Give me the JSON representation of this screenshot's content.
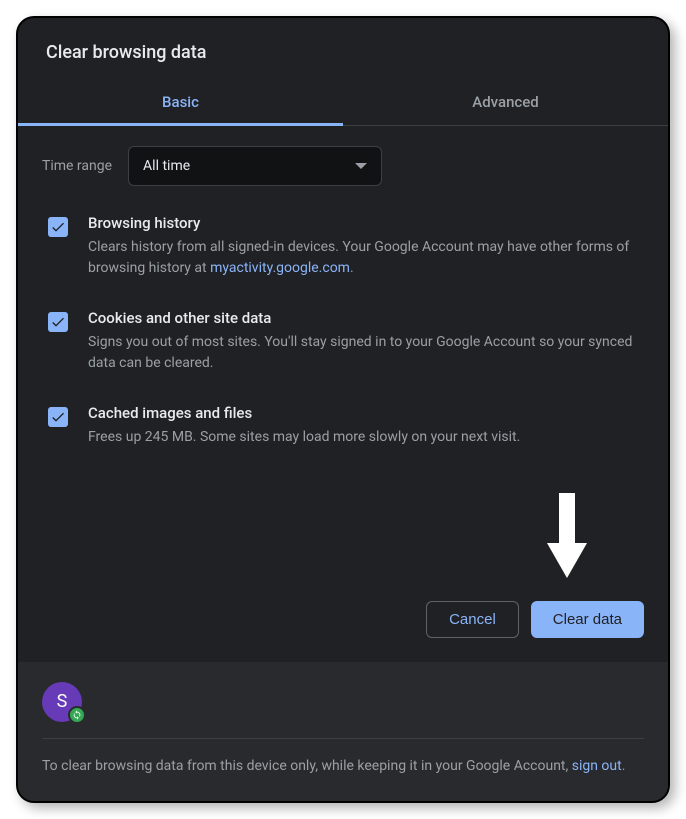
{
  "dialog": {
    "title": "Clear browsing data"
  },
  "tabs": {
    "basic": "Basic",
    "advanced": "Advanced"
  },
  "time_range": {
    "label": "Time range",
    "value": "All time"
  },
  "options": {
    "browsing_history": {
      "title": "Browsing history",
      "desc_prefix": "Clears history from all signed-in devices. Your Google Account may have other forms of browsing history at ",
      "link": "myactivity.google.com",
      "checked": true
    },
    "cookies": {
      "title": "Cookies and other site data",
      "desc": "Signs you out of most sites. You'll stay signed in to your Google Account so your synced data can be cleared.",
      "checked": true
    },
    "cache": {
      "title": "Cached images and files",
      "desc": "Frees up 245 MB. Some sites may load more slowly on your next visit.",
      "checked": true
    }
  },
  "buttons": {
    "cancel": "Cancel",
    "clear": "Clear data"
  },
  "footer": {
    "avatar_initial": "S",
    "text_prefix": "To clear browsing data from this device only, while keeping it in your Google Account, ",
    "link": "sign out",
    "text_suffix": "."
  }
}
